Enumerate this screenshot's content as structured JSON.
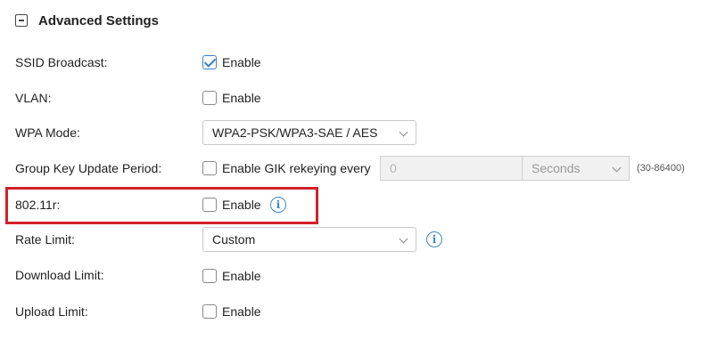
{
  "section": {
    "title": "Advanced Settings"
  },
  "fields": {
    "ssid_broadcast": {
      "label": "SSID Broadcast:",
      "option": "Enable",
      "checked": true
    },
    "vlan": {
      "label": "VLAN:",
      "option": "Enable",
      "checked": false
    },
    "wpa_mode": {
      "label": "WPA Mode:",
      "value": "WPA2-PSK/WPA3-SAE / AES"
    },
    "group_key": {
      "label": "Group Key Update Period:",
      "option": "Enable GIK rekeying every",
      "checked": false,
      "value": "0",
      "unit": "Seconds",
      "range": "(30-86400)"
    },
    "dot11r": {
      "label": "802.11r:",
      "option": "Enable",
      "checked": false,
      "info_icon": "info-icon"
    },
    "rate_limit": {
      "label": "Rate Limit:",
      "value": "Custom",
      "info_icon": "info-icon"
    },
    "download_limit": {
      "label": "Download Limit:",
      "option": "Enable",
      "checked": false
    },
    "upload_limit": {
      "label": "Upload Limit:",
      "option": "Enable",
      "checked": false
    }
  },
  "colors": {
    "accent": "#3e7fc2",
    "highlight": "#d12129",
    "info": "#3d88c8"
  }
}
